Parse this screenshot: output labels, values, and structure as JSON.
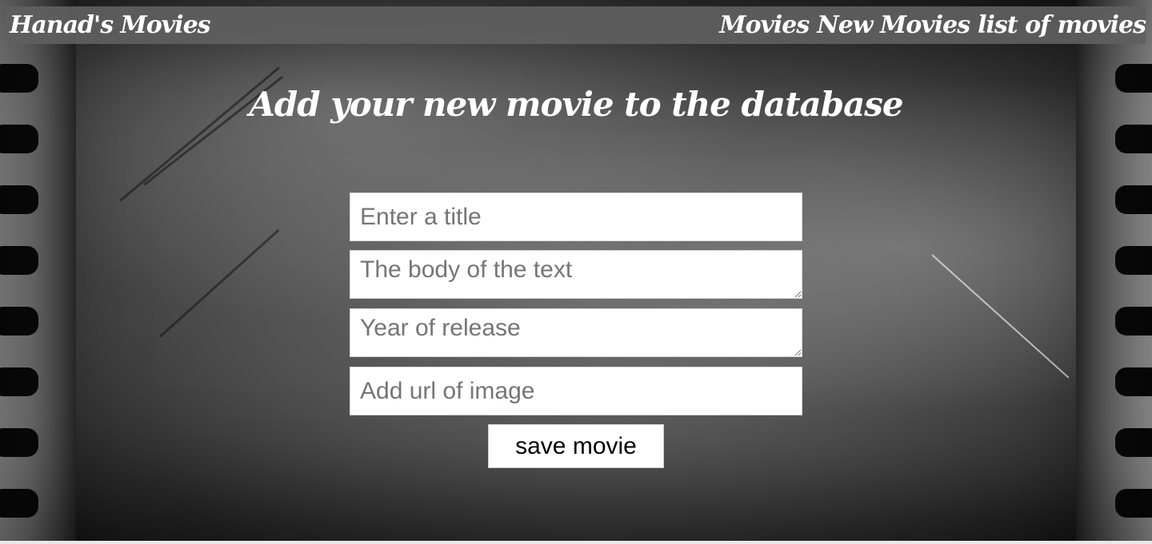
{
  "navbar": {
    "brand": "Hanad's Movies",
    "links": [
      "Movies",
      "New Movies",
      "list of movies"
    ]
  },
  "page": {
    "heading": "Add your new movie to the database"
  },
  "form": {
    "title_placeholder": "Enter a title",
    "body_placeholder": "The body of the text",
    "year_placeholder": "Year of release",
    "image_url_placeholder": "Add url of image",
    "save_label": "save movie"
  },
  "colors": {
    "navbar_bg": "#5f5f5f",
    "text": "#ffffff",
    "field_bg": "#ffffff"
  }
}
